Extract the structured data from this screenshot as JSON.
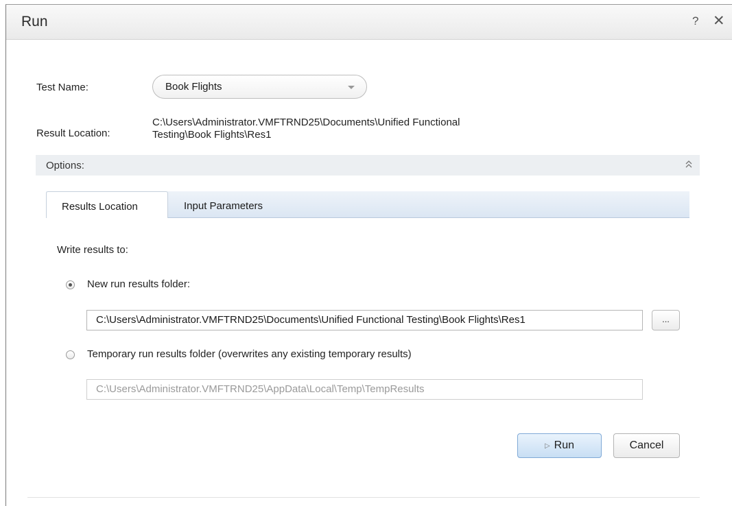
{
  "window": {
    "title": "Run",
    "help_glyph": "?",
    "close_glyph": "✕"
  },
  "form": {
    "test_name_label": "Test Name:",
    "test_name_value": "Book Flights",
    "result_location_label": "Result Location:",
    "result_location_line1": "C:\\Users\\Administrator.VMFTRND25\\Documents\\Unified Functional",
    "result_location_line2": "Testing\\Book Flights\\Res1"
  },
  "options": {
    "label": "Options:",
    "collapse_icon": "double-chevron-up-icon"
  },
  "tabs": [
    {
      "label": "Results Location",
      "active": true
    },
    {
      "label": "Input Parameters",
      "active": false
    }
  ],
  "results_location": {
    "write_results_label": "Write results to:",
    "new_folder_label": "New run results folder:",
    "new_folder_selected": true,
    "new_folder_path": "C:\\Users\\Administrator.VMFTRND25\\Documents\\Unified Functional Testing\\Book Flights\\Res1",
    "browse_label": "...",
    "temp_folder_label": "Temporary run results folder (overwrites any existing temporary results)",
    "temp_folder_selected": false,
    "temp_folder_path": "C:\\Users\\Administrator.VMFTRND25\\AppData\\Local\\Temp\\TempResults"
  },
  "buttons": {
    "run_label": "Run",
    "run_icon": "play-icon",
    "cancel_label": "Cancel"
  }
}
